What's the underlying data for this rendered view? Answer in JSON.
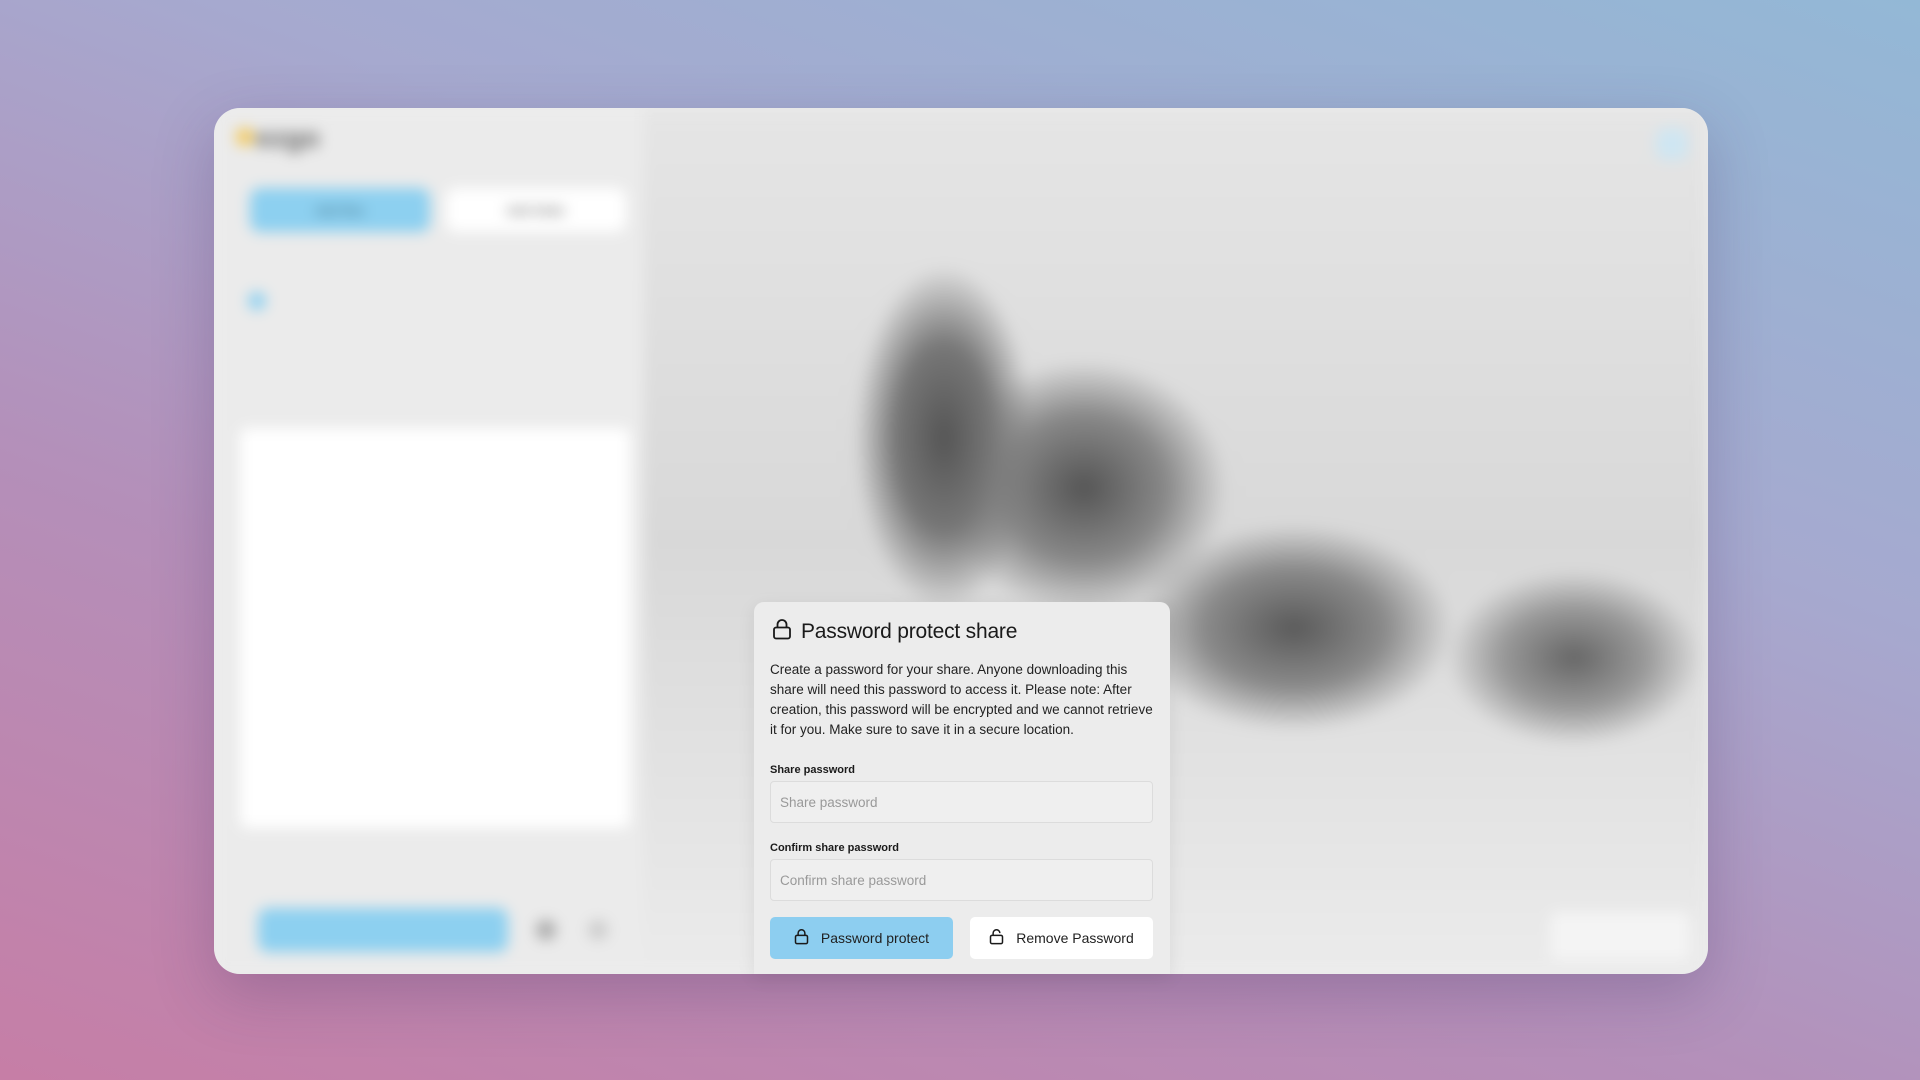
{
  "background_app": {
    "logo_text": "ezgo",
    "sidebar": {
      "primary_button": "Add files",
      "secondary_button": "Add folder"
    }
  },
  "modal": {
    "title": "Password protect share",
    "description": "Create a password for your share. Anyone downloading this share will need this password to access it. Please note: After creation, this password will be encrypted and we cannot retrieve it for you. Make sure to save it in a secure location.",
    "password_label": "Share password",
    "password_placeholder": "Share password",
    "confirm_label": "Confirm share password",
    "confirm_placeholder": "Confirm share password",
    "protect_button": "Password protect",
    "remove_button": "Remove Password"
  },
  "colors": {
    "accent": "#8dcef0",
    "modal_bg": "#ececec"
  },
  "icons": {
    "title_icon": "lock-icon",
    "protect_icon": "lock-icon",
    "remove_icon": "unlock-icon"
  }
}
